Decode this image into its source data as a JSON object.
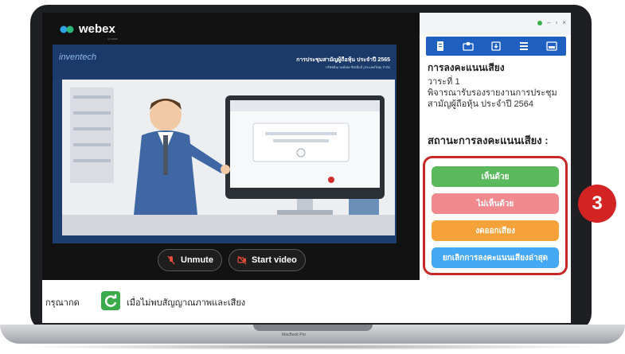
{
  "webex": {
    "app_name": "webex",
    "subtitle": "CLASSIC"
  },
  "slide": {
    "brand": "inventech",
    "title": "การประชุมสามัญผู้ถือหุ้น ประจำปี 2565",
    "subtitle": "บริษัทอินเวนท์เทค ซิสเท็มส์ (ประเทศไทย) จำกัด"
  },
  "controls": {
    "unmute_label": "Unmute",
    "start_video_label": "Start video"
  },
  "panel": {
    "heading": "การลงคะแนนเสียง",
    "agenda_line1": "วาระที่ 1",
    "agenda_line2": "พิจารณารับรองรายงานการประชุมสามัญผู้ถือหุ้น ประจำปี 2564",
    "status_label": "สถานะการลงคะแนนเสียง :",
    "vote_buttons": [
      {
        "label": "เห็นด้วย",
        "color": "#5cb85c"
      },
      {
        "label": "ไม่เห็นด้วย",
        "color": "#f08a8f"
      },
      {
        "label": "งดออกเสียง",
        "color": "#f5a23a"
      },
      {
        "label": "ยกเลิกการลงคะแนนเสียงล่าสุด",
        "color": "#45a8f5"
      }
    ]
  },
  "notice": {
    "pre_text": "กรุณากด",
    "post_text": "เมื่อไม่พบสัญญาณภาพและเสียง"
  },
  "step_badge": "3",
  "laptop_label": "MacBook Pro"
}
